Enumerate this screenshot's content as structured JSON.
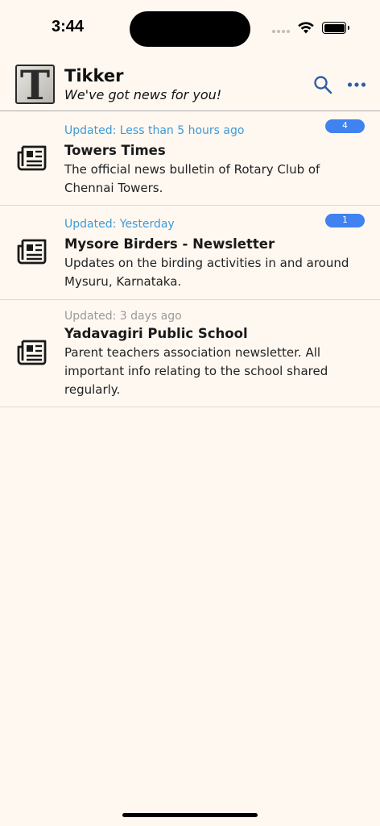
{
  "status_bar": {
    "time": "3:44"
  },
  "header": {
    "logo_letter": "T",
    "title": "Tikker",
    "tagline": "We've got news for you!"
  },
  "feeds": [
    {
      "updated": "Updated: Less than 5 hours ago",
      "title": "Towers Times",
      "description": "The official news bulletin of Rotary Club of Chennai Towers.",
      "badge": "4"
    },
    {
      "updated": "Updated: Yesterday",
      "title": "Mysore Birders - Newsletter",
      "description": "Updates on the birding activities in and around Mysuru, Karnataka.",
      "badge": "1"
    },
    {
      "updated": "Updated: 3 days ago",
      "title": "Yadavagiri Public School",
      "description": "Parent teachers association newsletter. All important info relating to the school shared regularly.",
      "badge": ""
    }
  ],
  "icons": {
    "search": "search-icon",
    "more": "more-icon",
    "feed": "newspaper-icon"
  },
  "colors": {
    "background": "#fff8f1",
    "accent": "#3d9ad8",
    "badge": "#3f82f0",
    "muted": "#9a9a9a",
    "icon_blue": "#2f5fa8"
  }
}
